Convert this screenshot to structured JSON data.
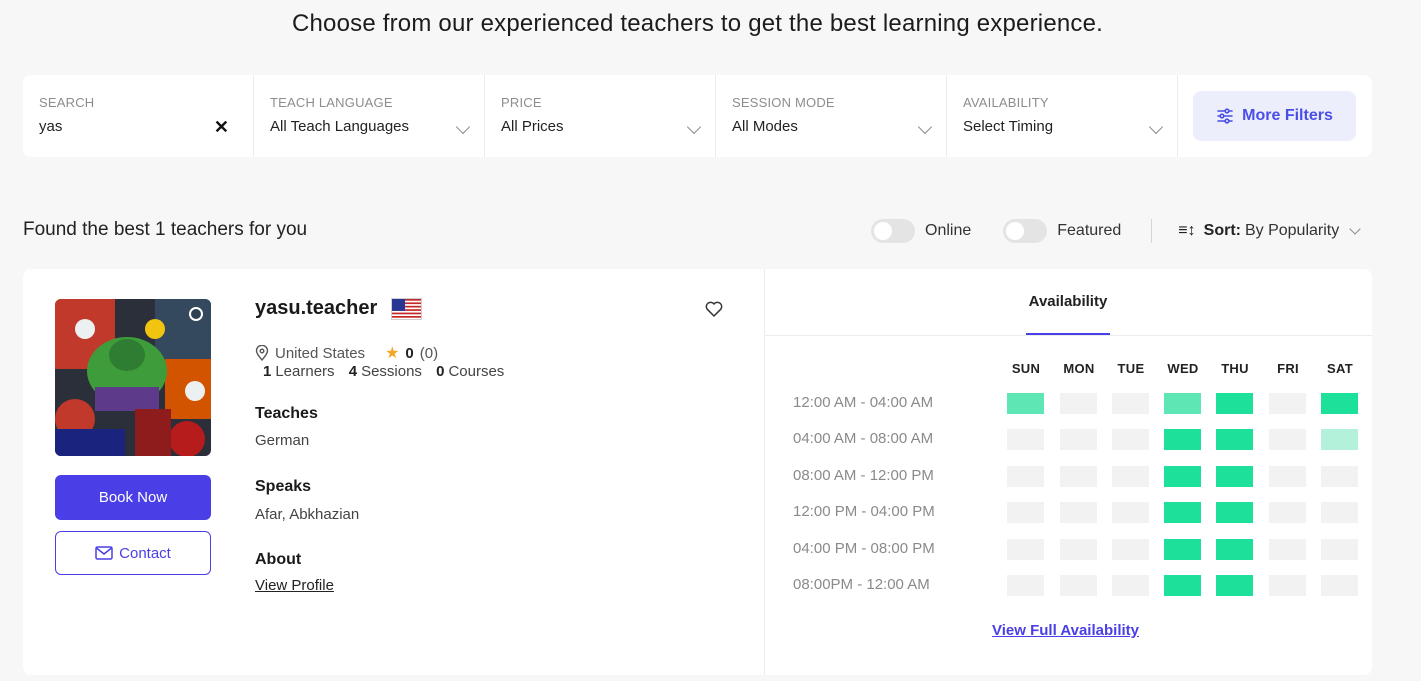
{
  "headline": "Choose from our experienced teachers to get the best learning experience.",
  "filters": {
    "search": {
      "label": "SEARCH",
      "value": "yas",
      "clear_icon": "close-icon"
    },
    "teach_language": {
      "label": "TEACH LANGUAGE",
      "value": "All Teach Languages"
    },
    "price": {
      "label": "PRICE",
      "value": "All Prices"
    },
    "session_mode": {
      "label": "SESSION MODE",
      "value": "All Modes"
    },
    "availability": {
      "label": "AVAILABILITY",
      "value": "Select Timing"
    },
    "more_filters": "More Filters"
  },
  "results": {
    "found_text": "Found the best 1 teachers for you",
    "toggle_online": "Online",
    "toggle_featured": "Featured",
    "sort_label": "Sort:",
    "sort_value": "By Popularity"
  },
  "teacher": {
    "name": "yasu.teacher",
    "country": "United States",
    "rating": "0",
    "rating_count": "(0)",
    "learners_count": "1",
    "learners_label": "Learners",
    "sessions_count": "4",
    "sessions_label": "Sessions",
    "courses_count": "0",
    "courses_label": "Courses",
    "teaches_heading": "Teaches",
    "teaches_value": "German",
    "speaks_heading": "Speaks",
    "speaks_value": "Afar, Abkhazian",
    "about_heading": "About",
    "view_profile": "View Profile",
    "book_now": "Book Now",
    "contact": "Contact"
  },
  "availability": {
    "tab_label": "Availability",
    "days": [
      "SUN",
      "MON",
      "TUE",
      "WED",
      "THU",
      "FRI",
      "SAT"
    ],
    "time_slots": [
      "12:00 AM - 04:00 AM",
      "04:00 AM - 08:00 AM",
      "08:00 AM - 12:00 PM",
      "12:00 PM - 04:00 PM",
      "04:00 PM - 08:00 PM",
      "08:00PM - 12:00 AM"
    ],
    "levels": [
      [
        0.7,
        0,
        0,
        0.7,
        1,
        0,
        1
      ],
      [
        0,
        0,
        0,
        1,
        1,
        0,
        0.35
      ],
      [
        0,
        0,
        0,
        1,
        1,
        0,
        0
      ],
      [
        0,
        0,
        0,
        1,
        1,
        0,
        0
      ],
      [
        0,
        0,
        0,
        1,
        1,
        0,
        0
      ],
      [
        0,
        0,
        0,
        1,
        1,
        0,
        0
      ]
    ],
    "colors": {
      "full": "#1de09a",
      "medium": "#5ee6b4",
      "light": "#b4f1db",
      "empty": "#f2f2f2"
    },
    "view_full": "View Full Availability"
  }
}
